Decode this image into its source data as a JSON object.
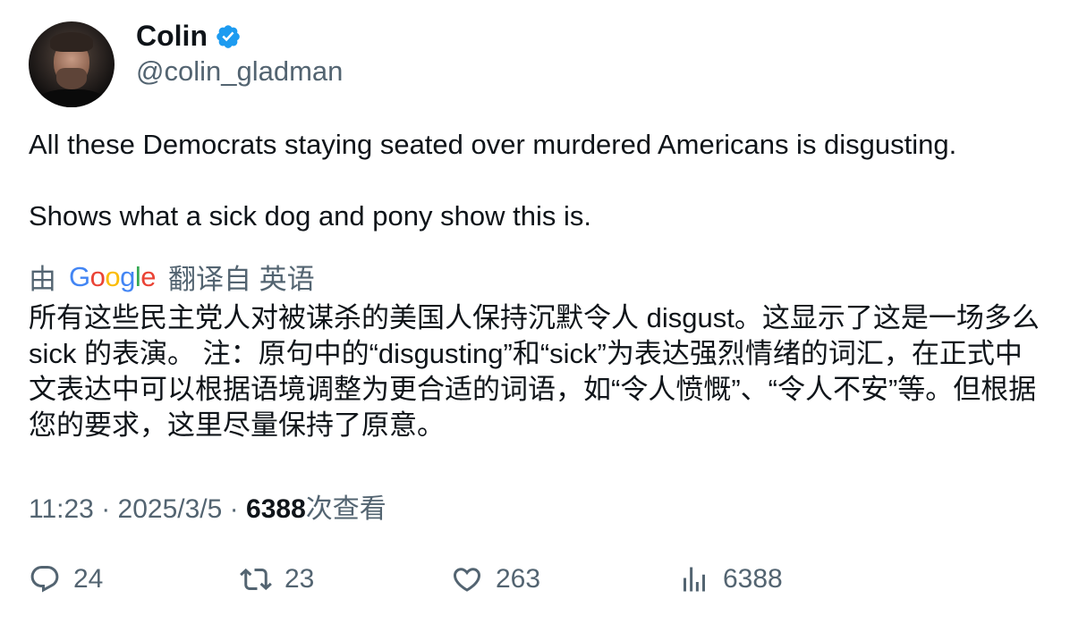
{
  "user": {
    "name": "Colin",
    "handle": "@colin_gladman",
    "verified": true
  },
  "tweet": {
    "line1": "All these Democrats staying seated over murdered Americans is disgusting.",
    "line2": "Shows what a sick dog and pony show this is."
  },
  "translation": {
    "prefix": "由",
    "provider": "Google",
    "suffix": "翻译自 英语",
    "text": "所有这些民主党人对被谋杀的美国人保持沉默令人 disgust。这显示了这是一场多么 sick 的表演。 注：原句中的“disgusting”和“sick”为表达强烈情绪的词汇，在正式中文表达中可以根据语境调整为更合适的词语，如“令人愤慨”、“令人不安”等。但根据您的要求，这里尽量保持了原意。"
  },
  "meta": {
    "time": "11:23",
    "date": "2025/3/5",
    "separator": "·",
    "views": "6388",
    "views_label": "次查看"
  },
  "actions": {
    "replies": "24",
    "reposts": "23",
    "likes": "263",
    "views": "6388"
  },
  "colors": {
    "verified_blue": "#1d9bf0",
    "secondary_text": "#536471",
    "primary_text": "#0f1419"
  }
}
